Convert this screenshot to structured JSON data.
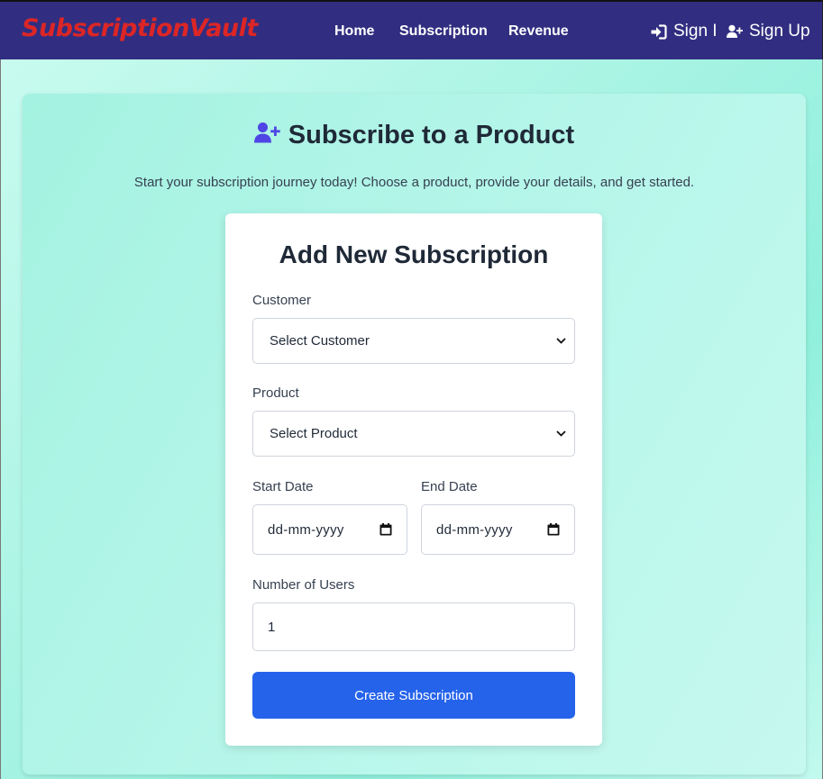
{
  "header": {
    "brand": "SubscriptionVault",
    "nav": [
      "Home",
      "Subscription",
      "Revenue"
    ],
    "sign_in_label": "Sign I",
    "sign_up_label": "Sign Up"
  },
  "hero": {
    "title": "Subscribe to a Product",
    "subtitle": "Start your subscription journey today! Choose a product, provide your details, and get started.",
    "icon": "user-plus-icon"
  },
  "form": {
    "title": "Add New Subscription",
    "customer_label": "Customer",
    "customer_value": "Select Customer",
    "product_label": "Product",
    "product_value": "Select Product",
    "start_date_label": "Start Date",
    "start_date_placeholder": "dd-mm-yyyy",
    "end_date_label": "End Date",
    "end_date_placeholder": "dd-mm-yyyy",
    "users_label": "Number of Users",
    "users_value": "1",
    "submit_label": "Create Subscription"
  },
  "colors": {
    "navbar": "#312e81",
    "brand": "#dc2626",
    "accent": "#2563eb",
    "icon_purple": "#4f46e5"
  }
}
